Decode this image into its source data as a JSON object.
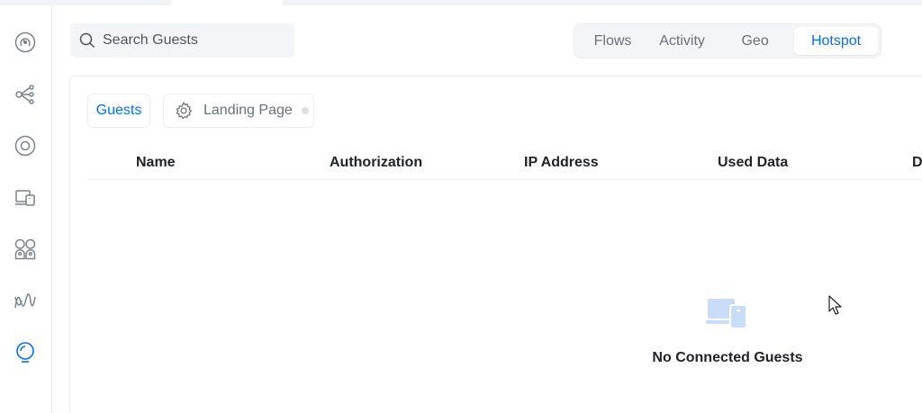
{
  "search": {
    "placeholder": "Search Guests"
  },
  "view_tabs": [
    {
      "label": "Flows",
      "active": false
    },
    {
      "label": "Activity",
      "active": false
    },
    {
      "label": "Geo",
      "active": false
    },
    {
      "label": "Hotspot",
      "active": true
    }
  ],
  "subtabs": {
    "guests": "Guests",
    "landing_page": "Landing Page"
  },
  "table": {
    "columns": [
      "Name",
      "Authorization",
      "IP Address",
      "Used Data",
      "D"
    ]
  },
  "empty_state": {
    "message": "No Connected Guests"
  },
  "sidebar": {
    "items": [
      {
        "icon": "dashboard-icon",
        "active": false
      },
      {
        "icon": "topology-icon",
        "active": false
      },
      {
        "icon": "access-point-icon",
        "active": false
      },
      {
        "icon": "client-devices-icon",
        "active": false
      },
      {
        "icon": "users-icon",
        "active": false
      },
      {
        "icon": "insights-waves-icon",
        "active": false
      },
      {
        "icon": "hotspot-icon",
        "active": true
      }
    ]
  },
  "colors": {
    "accent": "#006fff",
    "text": "#212327",
    "muted": "#6b7076",
    "border": "#eceef0",
    "empty_icon": "#c9dcf8"
  }
}
